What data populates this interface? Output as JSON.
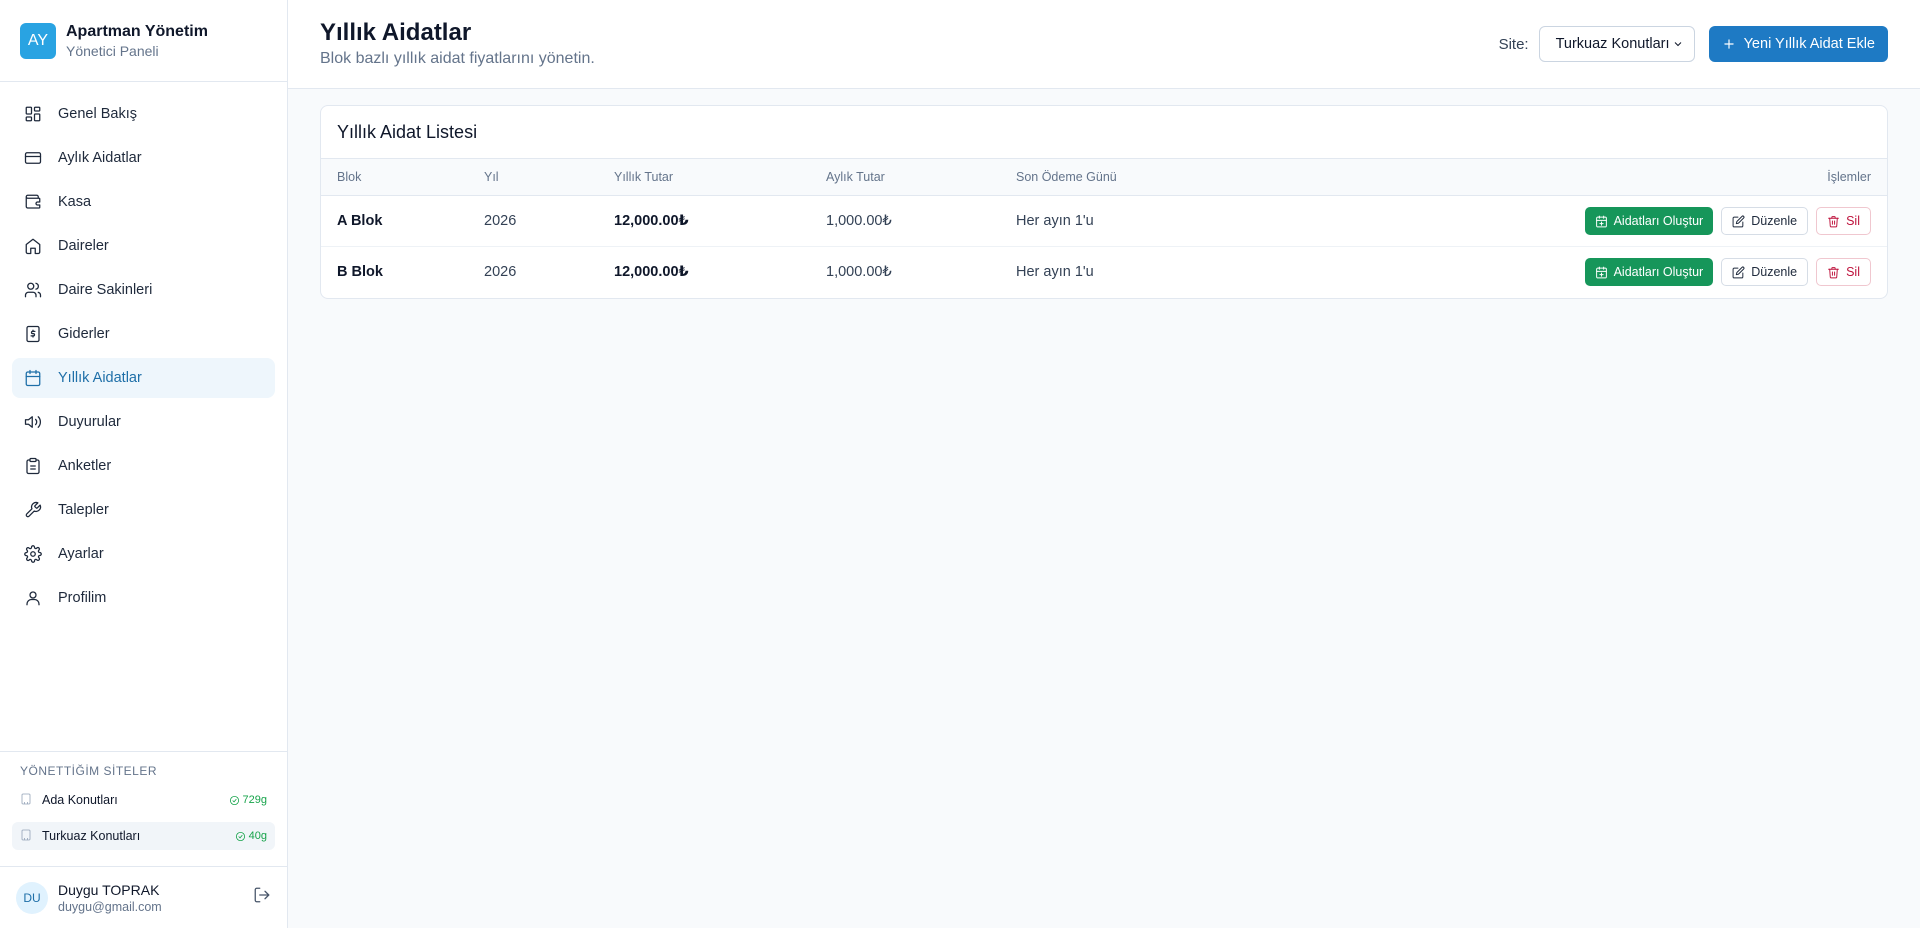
{
  "brand": {
    "logo": "AY",
    "title": "Apartman Yönetim",
    "subtitle": "Yönetici Paneli"
  },
  "nav": [
    {
      "label": "Genel Bakış",
      "icon": "dashboard-icon"
    },
    {
      "label": "Aylık Aidatlar",
      "icon": "credit-card-icon"
    },
    {
      "label": "Kasa",
      "icon": "wallet-icon"
    },
    {
      "label": "Daireler",
      "icon": "home-icon"
    },
    {
      "label": "Daire Sakinleri",
      "icon": "users-icon"
    },
    {
      "label": "Giderler",
      "icon": "receipt-icon"
    },
    {
      "label": "Yıllık Aidatlar",
      "icon": "calendar-icon",
      "active": true
    },
    {
      "label": "Duyurular",
      "icon": "megaphone-icon"
    },
    {
      "label": "Anketler",
      "icon": "clipboard-icon"
    },
    {
      "label": "Talepler",
      "icon": "wrench-icon"
    },
    {
      "label": "Ayarlar",
      "icon": "gear-icon"
    },
    {
      "label": "Profilim",
      "icon": "user-icon"
    }
  ],
  "sites": {
    "title": "YÖNETTİĞİM SİTELER",
    "items": [
      {
        "name": "Ada Konutları",
        "badge": "729g"
      },
      {
        "name": "Turkuaz Konutları",
        "badge": "40g",
        "active": true
      }
    ]
  },
  "user": {
    "initials": "DU",
    "name": "Duygu TOPRAK",
    "email": "duygu@gmail.com"
  },
  "header": {
    "title": "Yıllık Aidatlar",
    "subtitle": "Blok bazlı yıllık aidat fiyatlarını yönetin.",
    "site_label": "Site:",
    "site_selected": "Turkuaz Konutları",
    "add_button": "Yeni Yıllık Aidat Ekle"
  },
  "table": {
    "title": "Yıllık Aidat Listesi",
    "columns": [
      "Blok",
      "Yıl",
      "Yıllık Tutar",
      "Aylık Tutar",
      "Son Ödeme Günü",
      "İşlemler"
    ],
    "rows": [
      {
        "blok": "A Blok",
        "yil": "2026",
        "yillik": "12,000.00₺",
        "aylik": "1,000.00₺",
        "son_odeme": "Her ayın 1'u"
      },
      {
        "blok": "B Blok",
        "yil": "2026",
        "yillik": "12,000.00₺",
        "aylik": "1,000.00₺",
        "son_odeme": "Her ayın 1'u"
      }
    ],
    "actions": {
      "generate": "Aidatları Oluştur",
      "edit": "Düzenle",
      "delete": "Sil"
    }
  },
  "colors": {
    "accent": "#1e7ac4",
    "active_nav_bg": "#eef6fc",
    "success": "#16965a",
    "danger": "#be123c"
  }
}
